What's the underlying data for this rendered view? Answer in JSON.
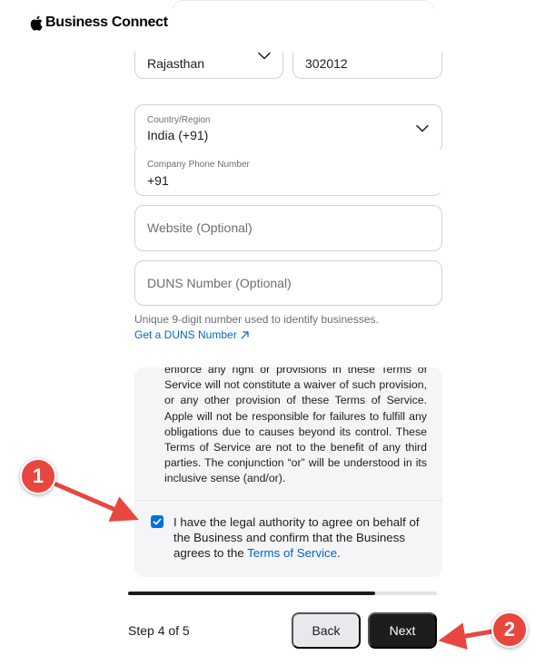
{
  "header": {
    "brand": "Business Connect",
    "logo_icon": "apple-logo-icon"
  },
  "form": {
    "state": {
      "value": "Rajasthan",
      "icon": "chevron-down-icon"
    },
    "postal_code": {
      "value": "302012"
    },
    "country": {
      "label": "Country/Region",
      "value": "India (+91)",
      "icon": "chevron-down-icon"
    },
    "phone": {
      "label": "Company Phone Number",
      "value": "+91"
    },
    "website": {
      "placeholder": "Website (Optional)"
    },
    "duns": {
      "placeholder": "DUNS Number (Optional)"
    },
    "duns_helper": "Unique 9-digit number used to identify businesses.",
    "duns_link": "Get a DUNS Number",
    "duns_link_icon": "arrow-up-right-icon"
  },
  "terms": {
    "text": "enforce any right or provisions in these Terms of Service will not constitute a waiver of such provision, or any other provision of these Terms of Service. Apple will not be responsible for failures to fulfill any obligations due to causes beyond its control. These Terms of Service are not to the benefit of any third parties. The conjunction “or” will be understood in its inclusive sense (and/or).",
    "consent_checked": true,
    "consent_text": "I have the legal authority to agree on behalf of the Business and confirm that the Business agrees to the ",
    "consent_link": "Terms of Service",
    "consent_end": "."
  },
  "progress": {
    "fraction": 0.8
  },
  "footer": {
    "step_label": "Step 4 of 5",
    "back_label": "Back",
    "next_label": "Next"
  },
  "annotations": [
    {
      "number": "1",
      "color": "#e8473f"
    },
    {
      "number": "2",
      "color": "#e8473f"
    }
  ],
  "colors": {
    "accent": "#0071e3",
    "link": "#0066cc",
    "primary_button": "#1d1d1f",
    "annotation": "#e8473f"
  }
}
